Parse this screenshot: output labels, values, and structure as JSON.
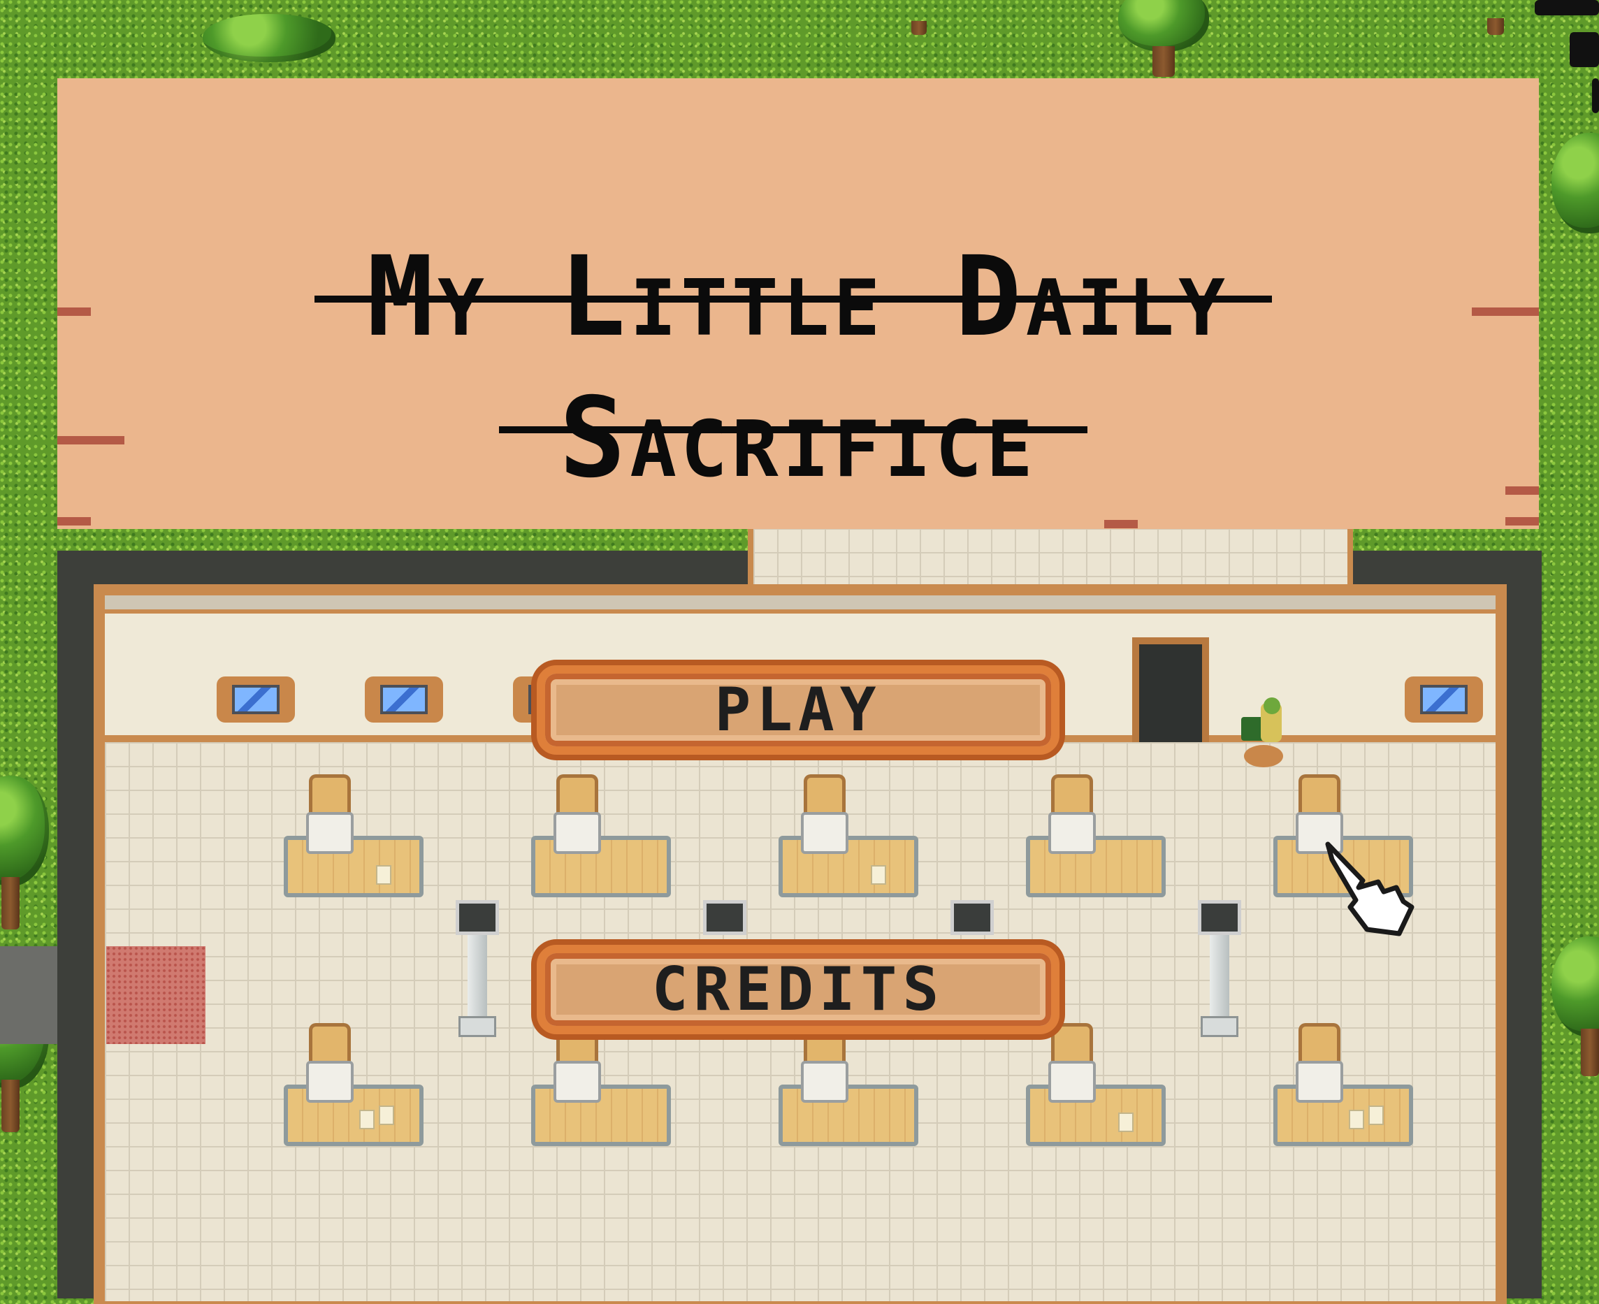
{
  "game": {
    "title_line1": "My Little Daily",
    "title_line2": "Sacrifice"
  },
  "menu": {
    "play_label": "PLAY",
    "credits_label": "CREDITS"
  },
  "colors": {
    "title_panel": "#ebb68d",
    "button_border": "#df7f3a",
    "button_fill": "#d9a473",
    "grass": "#5f9a2a",
    "floor": "#ebe4d2"
  },
  "icons": [
    "pointing-hand-cursor-icon",
    "user-icon",
    "video-icon"
  ]
}
